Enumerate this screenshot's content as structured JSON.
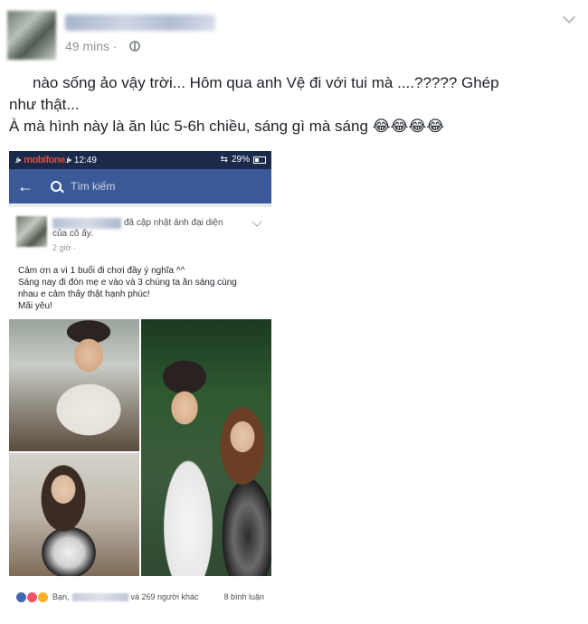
{
  "post": {
    "time": "49 mins ·",
    "text_line1": "nào sống ảo vậy trời... Hôm qua anh Vệ đi với tui mà       ....????? Ghép",
    "text_line2": "như thật...",
    "text_line3": "À mà hình này là ăn lúc 5-6h chiều, sáng gì mà sáng",
    "emojis": "😂😂😂😂"
  },
  "phone": {
    "status": {
      "carrier": "mobifone",
      "clock": "12:49",
      "battery": "29%"
    },
    "search": {
      "placeholder": "Tìm kiếm"
    },
    "inner_post": {
      "action": "đã cập nhật ảnh đại diện",
      "action_line2": "của cô ấy.",
      "time": "2 giờ ·",
      "caption_line1": "Cảm ơn a vì 1 buổi đi chơi đầy ý nghĩa ^^",
      "caption_line2": "Sáng nay đi đón mẹ e vào và 3 chúng ta ăn sáng cùng",
      "caption_line3": "nhau e cảm thấy thật hạnh phúc!",
      "caption_line4": "Mãi yêu!",
      "reactions_prefix": "Bạn,",
      "reactions_suffix": "và 269 người khác",
      "comments": "8 bình luận"
    }
  }
}
